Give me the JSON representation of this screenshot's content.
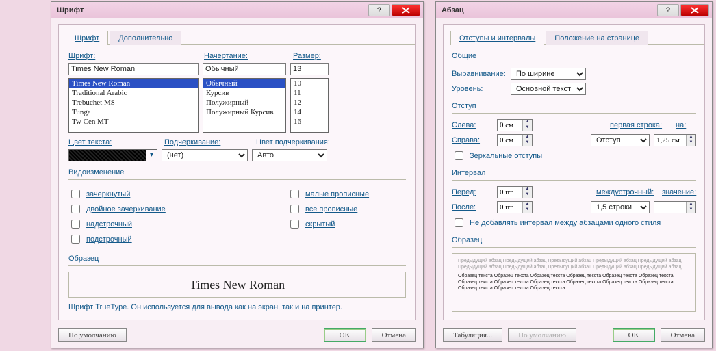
{
  "font_dialog": {
    "title": "Шрифт",
    "tabs": {
      "font": "Шрифт",
      "advanced": "Дополнительно"
    },
    "labels": {
      "font": "Шрифт:",
      "style": "Начертание:",
      "size": "Размер:",
      "text_color": "Цвет текста:",
      "underline": "Подчеркивание:",
      "underline_color": "Цвет подчеркивания:",
      "effects_group": "Видоизменение",
      "sample_group": "Образец"
    },
    "font_value": "Times New Roman",
    "font_list": [
      "Times New Roman",
      "Traditional Arabic",
      "Trebuchet MS",
      "Tunga",
      "Tw Cen MT"
    ],
    "style_value": "Обычный",
    "style_list": [
      "Обычный",
      "Курсив",
      "Полужирный",
      "Полужирный Курсив"
    ],
    "size_value": "13",
    "size_list": [
      "10",
      "11",
      "12",
      "14",
      "16"
    ],
    "underline_value": "(нет)",
    "underline_color_value": "Авто",
    "effects": {
      "strike": "зачеркнутый",
      "dblstrike": "двойное зачеркивание",
      "superscript": "надстрочный",
      "subscript": "подстрочный",
      "smallcaps": "малые прописные",
      "allcaps": "все прописные",
      "hidden": "скрытый"
    },
    "sample_text": "Times New Roman",
    "hint": "Шрифт TrueType. Он используется для вывода как на экран, так и на принтер.",
    "buttons": {
      "default": "По умолчанию",
      "ok": "OK",
      "cancel": "Отмена"
    }
  },
  "para_dialog": {
    "title": "Абзац",
    "tabs": {
      "indent": "Отступы и интервалы",
      "position": "Положение на странице"
    },
    "groups": {
      "general": "Общие",
      "alignment": "Выравнивание:",
      "level": "Уровень:",
      "indent": "Отступ",
      "left": "Слева:",
      "right": "Справа:",
      "first_line": "первая строка:",
      "by": "на:",
      "mirror": "Зеркальные отступы",
      "spacing": "Интервал",
      "before": "Перед:",
      "after": "После:",
      "line_spacing": "междустрочный:",
      "at": "значение:",
      "no_space_same": "Не добавлять интервал между абзацами одного стиля",
      "sample": "Образец"
    },
    "alignment_value": "По ширине",
    "level_value": "Основной текст",
    "left_value": "0 см",
    "right_value": "0 см",
    "first_line_value": "Отступ",
    "by_value": "1,25 см",
    "before_value": "0 пт",
    "after_value": "0 пт",
    "line_spacing_value": "1,5 строки",
    "at_value": "",
    "sample_gray": "Предыдущий абзац Предыдущий абзац Предыдущий абзац Предыдущий абзац Предыдущий абзац Предыдущий абзац Предыдущий абзац Предыдущий абзац Предыдущий абзац Предыдущий абзац",
    "sample_dark": "Образец текста Образец текста Образец текста Образец текста Образец текста Образец текста Образец текста Образец текста Образец текста Образец текста Образец текста Образец текста Образец текста Образец текста Образец текста",
    "buttons": {
      "tabs": "Табуляция...",
      "default": "По умолчанию",
      "ok": "OK",
      "cancel": "Отмена"
    }
  }
}
